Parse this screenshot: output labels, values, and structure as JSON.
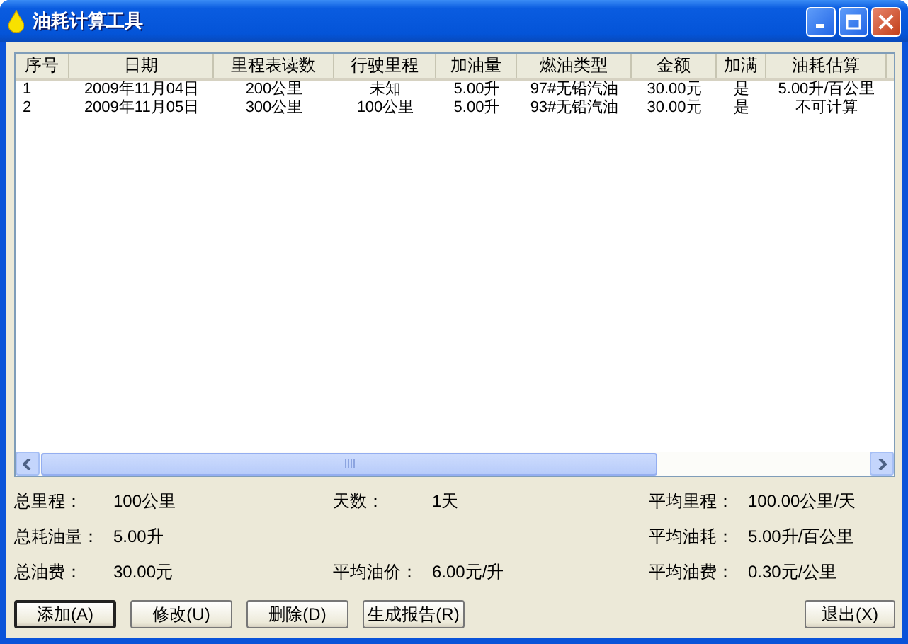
{
  "window": {
    "title": "油耗计算工具"
  },
  "table": {
    "columns": [
      "序号",
      "日期",
      "里程表读数",
      "行驶里程",
      "加油量",
      "燃油类型",
      "金额",
      "加满",
      "油耗估算"
    ],
    "rows": [
      [
        "1",
        "2009年11月04日",
        "200公里",
        "未知",
        "5.00升",
        "97#无铅汽油",
        "30.00元",
        "是",
        "5.00升/百公里"
      ],
      [
        "2",
        "2009年11月05日",
        "300公里",
        "100公里",
        "5.00升",
        "93#无铅汽油",
        "30.00元",
        "是",
        "不可计算"
      ]
    ]
  },
  "summary": [
    {
      "left": {
        "label": "总里程：",
        "value": "100公里"
      },
      "middle": {
        "label": "天数：",
        "value": "1天"
      },
      "right": {
        "label": "平均里程：",
        "value": "100.00公里/天"
      }
    },
    {
      "left": {
        "label": "总耗油量：",
        "value": "5.00升"
      },
      "right": {
        "label": "平均油耗：",
        "value": "5.00升/百公里"
      }
    },
    {
      "left": {
        "label": "总油费：",
        "value": "30.00元"
      },
      "middle": {
        "label": "平均油价：",
        "value": "6.00元/升"
      },
      "right": {
        "label": "平均油费：",
        "value": "0.30元/公里"
      }
    }
  ],
  "buttons": [
    {
      "label": "添加(A)",
      "default": true
    },
    {
      "label": "修改(U)",
      "default": false
    },
    {
      "label": "删除(D)",
      "default": false
    },
    {
      "label": "生成报告(R)",
      "default": false
    }
  ],
  "exit_button": {
    "label": "退出(X)"
  }
}
